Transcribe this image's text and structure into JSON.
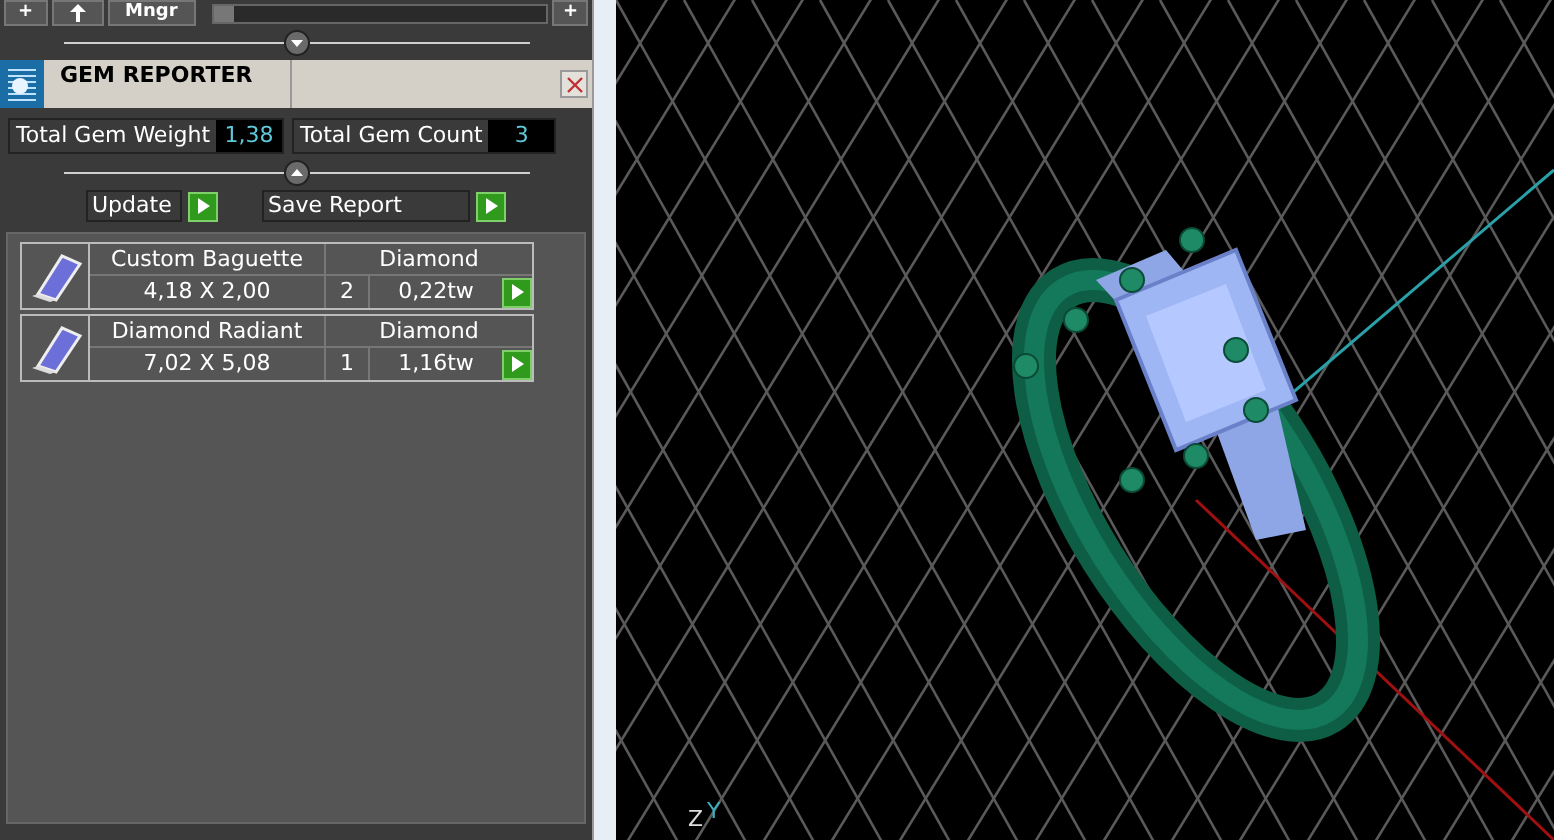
{
  "toolbar": {
    "buttons": [
      {
        "kind": "text",
        "label": "+"
      },
      {
        "kind": "icon"
      },
      {
        "kind": "text",
        "label": "Mngr"
      }
    ],
    "slider": {
      "level": 0
    },
    "end_button": "+"
  },
  "panel": {
    "title": "GEM REPORTER",
    "stats": [
      {
        "label": "Total Gem Weight",
        "value": "1,38"
      },
      {
        "label": "Total Gem Count",
        "value": "3"
      }
    ],
    "actions": [
      "Update",
      "Save Report"
    ],
    "gems": [
      {
        "name": "Custom Baguette",
        "type": "Diamond",
        "size": "4,18 X 2,00",
        "count": "2",
        "weight": "0,22tw"
      },
      {
        "name": "Diamond Radiant",
        "type": "Diamond",
        "size": "7,02 X 5,08",
        "count": "1",
        "weight": "1,16tw"
      }
    ]
  },
  "viewport": {
    "axes": [
      "Z",
      "Y"
    ]
  }
}
